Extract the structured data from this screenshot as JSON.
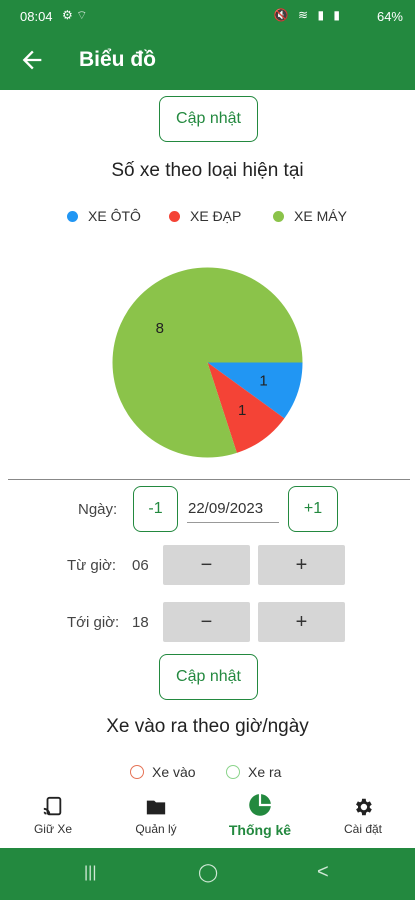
{
  "status_bar": {
    "time": "08:04",
    "battery": "64%",
    "left_icons": "⚙ ⌔",
    "right_icons": "🔇 ≋ ▮ ▮"
  },
  "app_bar": {
    "title": "Biểu đồ"
  },
  "update_button": "Cập nhật",
  "pie": {
    "title": "Số xe theo loại hiện tại",
    "legend": [
      {
        "label": "XE ÔTÔ",
        "color": "#2196f3"
      },
      {
        "label": "XE ĐẠP",
        "color": "#f44336"
      },
      {
        "label": "XE MÁY",
        "color": "#8bc34a"
      }
    ]
  },
  "filters": {
    "date_label": "Ngày:",
    "minus_day": "-1",
    "date_value": "22/09/2023",
    "plus_day": "+1",
    "from_label": "Từ giờ:",
    "from_value": "06",
    "to_label": "Tới giờ:",
    "to_value": "18",
    "minus": "−",
    "plus": "+",
    "update_button": "Cập nhật"
  },
  "line_chart": {
    "title": "Xe vào ra theo giờ/ngày",
    "legend": [
      {
        "label": "Xe vào",
        "color": "#e57356"
      },
      {
        "label": "Xe ra",
        "color": "#8bd48b"
      }
    ]
  },
  "bottom_nav": [
    {
      "label": "Giữ Xe",
      "icon": "parking-cast-icon"
    },
    {
      "label": "Quản lý",
      "icon": "folder-icon"
    },
    {
      "label": "Thống kê",
      "icon": "pie-chart-icon"
    },
    {
      "label": "Cài đặt",
      "icon": "gear-icon"
    }
  ],
  "system_nav": {
    "recent": "|||",
    "home": "◯",
    "back": "<"
  },
  "chart_data": {
    "type": "pie",
    "title": "Số xe theo loại hiện tại",
    "categories": [
      "XE ÔTÔ",
      "XE ĐẠP",
      "XE MÁY"
    ],
    "values": [
      1,
      1,
      8
    ],
    "colors": [
      "#2196f3",
      "#f44336",
      "#8bc34a"
    ],
    "legend_position": "top"
  }
}
